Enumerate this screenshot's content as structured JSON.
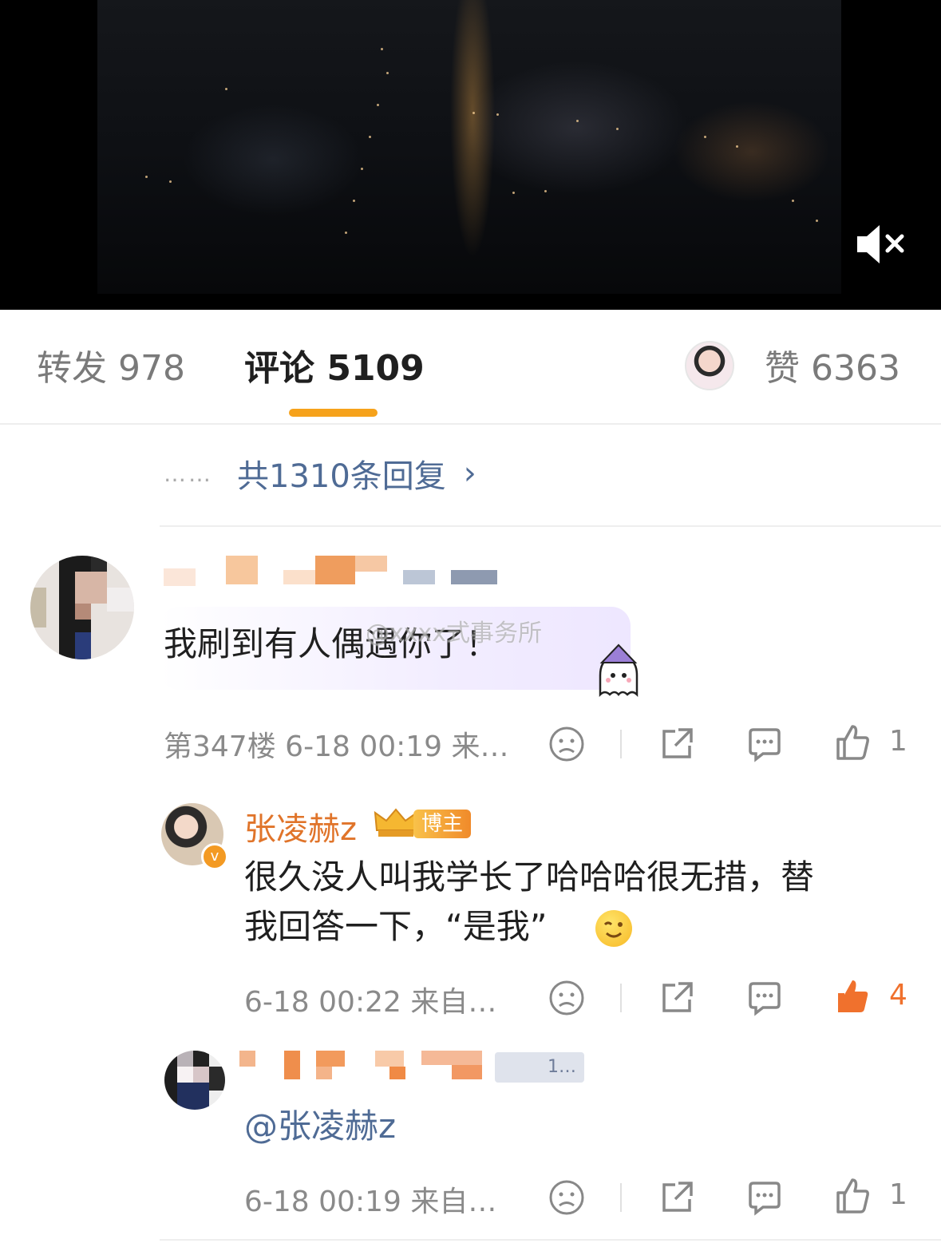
{
  "video": {
    "muted_icon": "speaker-muted-icon"
  },
  "tabs": [
    {
      "label": "转发",
      "count": "978"
    },
    {
      "label": "评论",
      "count": "5109",
      "active": true
    },
    {
      "label": "赞",
      "count": "6363"
    }
  ],
  "replies_link": {
    "dots": "……",
    "label": "共1310条回复",
    "chevron": "›"
  },
  "watermark": "@xxxx式事务所",
  "comments": [
    {
      "text": "我刷到有人偶遇你了！",
      "floor": "第347楼",
      "time": "6-18 00:19",
      "source": "来…",
      "likes": "1"
    },
    {
      "name": "张凌赫z",
      "badge": "博主",
      "text_line1": "很久没人叫我学长了哈哈哈很无措，替",
      "text_line2": "我回答一下，“是我”",
      "time": "6-18 00:22",
      "source": "来自…",
      "likes": "4"
    },
    {
      "badge_partial": "1…",
      "text": "@张凌赫z",
      "time": "6-18 00:19",
      "source": "来自…",
      "likes": "1"
    }
  ],
  "colors": {
    "accent": "#f6a21b",
    "link": "#4f6b95",
    "blogger": "#e0742a",
    "liked": "#f0712d"
  }
}
